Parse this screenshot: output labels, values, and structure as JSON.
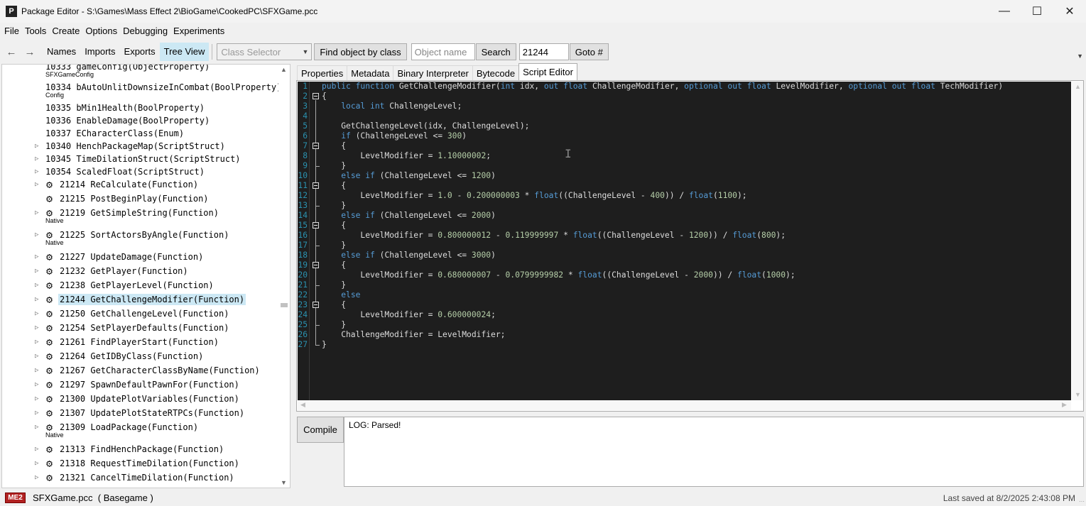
{
  "window": {
    "title": "Package Editor - S:\\Games\\Mass Effect 2\\BioGame\\CookedPC\\SFXGame.pcc",
    "icon_letter": "P",
    "minimize": "—",
    "maximize": "☐",
    "close": "✕"
  },
  "menu": [
    "File",
    "Tools",
    "Create",
    "Options",
    "Debugging",
    "Experiments"
  ],
  "toolbar": {
    "back": "←",
    "forward": "→",
    "links": [
      "Names",
      "Imports",
      "Exports",
      "Tree View"
    ],
    "active_link": "Tree View",
    "class_selector": "Class Selector",
    "find_by_class": "Find object by class",
    "object_name_placeholder": "Object name",
    "search": "Search",
    "goto_value": "21244",
    "goto": "Goto #"
  },
  "tree": {
    "rows": [
      {
        "label": "10333 gameConfig(ObjectProperty)",
        "sub": "SFXGameConfig",
        "expander": false,
        "gear": false
      },
      {
        "label": "10334 bAutoUnlitDownsizeInCombat(BoolProperty)",
        "sub": "Config",
        "expander": false,
        "gear": false
      },
      {
        "label": "10335 bMin1Health(BoolProperty)",
        "sub": "",
        "expander": false,
        "gear": false
      },
      {
        "label": "10336 EnableDamage(BoolProperty)",
        "sub": "",
        "expander": false,
        "gear": false
      },
      {
        "label": "10337 ECharacterClass(Enum)",
        "sub": "",
        "expander": false,
        "gear": false
      },
      {
        "label": "10340 HenchPackageMap(ScriptStruct)",
        "sub": "",
        "expander": true,
        "gear": false
      },
      {
        "label": "10345 TimeDilationStruct(ScriptStruct)",
        "sub": "",
        "expander": true,
        "gear": false
      },
      {
        "label": "10354 ScaledFloat(ScriptStruct)",
        "sub": "",
        "expander": true,
        "gear": false
      },
      {
        "label": "21214 ReCalculate(Function)",
        "sub": "",
        "expander": true,
        "gear": true
      },
      {
        "label": "21215 PostBeginPlay(Function)",
        "sub": "",
        "expander": false,
        "gear": true
      },
      {
        "label": "21219 GetSimpleString(Function)",
        "sub": "Native",
        "expander": true,
        "gear": true
      },
      {
        "label": "21225 SortActorsByAngle(Function)",
        "sub": "Native",
        "expander": true,
        "gear": true
      },
      {
        "label": "21227 UpdateDamage(Function)",
        "sub": "",
        "expander": true,
        "gear": true
      },
      {
        "label": "21232 GetPlayer(Function)",
        "sub": "",
        "expander": true,
        "gear": true
      },
      {
        "label": "21238 GetPlayerLevel(Function)",
        "sub": "",
        "expander": true,
        "gear": true
      },
      {
        "label": "21244 GetChallengeModifier(Function)",
        "sub": "",
        "expander": true,
        "gear": true,
        "selected": true
      },
      {
        "label": "21250 GetChallengeLevel(Function)",
        "sub": "",
        "expander": true,
        "gear": true
      },
      {
        "label": "21254 SetPlayerDefaults(Function)",
        "sub": "",
        "expander": true,
        "gear": true
      },
      {
        "label": "21261 FindPlayerStart(Function)",
        "sub": "",
        "expander": true,
        "gear": true
      },
      {
        "label": "21264 GetIDByClass(Function)",
        "sub": "",
        "expander": true,
        "gear": true
      },
      {
        "label": "21267 GetCharacterClassByName(Function)",
        "sub": "",
        "expander": true,
        "gear": true
      },
      {
        "label": "21297 SpawnDefaultPawnFor(Function)",
        "sub": "",
        "expander": true,
        "gear": true
      },
      {
        "label": "21300 UpdatePlotVariables(Function)",
        "sub": "",
        "expander": true,
        "gear": true
      },
      {
        "label": "21307 UpdatePlotStateRTPCs(Function)",
        "sub": "",
        "expander": true,
        "gear": true
      },
      {
        "label": "21309 LoadPackage(Function)",
        "sub": "Native",
        "expander": true,
        "gear": true
      },
      {
        "label": "21313 FindHenchPackage(Function)",
        "sub": "",
        "expander": true,
        "gear": true
      },
      {
        "label": "21318 RequestTimeDilation(Function)",
        "sub": "",
        "expander": true,
        "gear": true
      },
      {
        "label": "21321 CancelTimeDilation(Function)",
        "sub": "",
        "expander": true,
        "gear": true
      }
    ]
  },
  "tabs": [
    "Properties",
    "Metadata",
    "Binary Interpreter",
    "Bytecode",
    "Script Editor"
  ],
  "active_tab": "Script Editor",
  "code": {
    "line_numbers": [
      "1",
      "2",
      "3",
      "4",
      "5",
      "6",
      "7",
      "8",
      "9",
      "10",
      "11",
      "12",
      "13",
      "14",
      "15",
      "16",
      "17",
      "18",
      "19",
      "20",
      "21",
      "22",
      "23",
      "24",
      "25",
      "26",
      "27"
    ],
    "lines": [
      [
        [
          "k",
          "public"
        ],
        [
          "t",
          " "
        ],
        [
          "k",
          "function"
        ],
        [
          "t",
          " GetChallengeModifier("
        ],
        [
          "k",
          "int"
        ],
        [
          "t",
          " idx, "
        ],
        [
          "k",
          "out"
        ],
        [
          "t",
          " "
        ],
        [
          "k",
          "float"
        ],
        [
          "t",
          " ChallengeModifier, "
        ],
        [
          "k",
          "optional"
        ],
        [
          "t",
          " "
        ],
        [
          "k",
          "out"
        ],
        [
          "t",
          " "
        ],
        [
          "k",
          "float"
        ],
        [
          "t",
          " LevelModifier, "
        ],
        [
          "k",
          "optional"
        ],
        [
          "t",
          " "
        ],
        [
          "k",
          "out"
        ],
        [
          "t",
          " "
        ],
        [
          "k",
          "float"
        ],
        [
          "t",
          " TechModifier)"
        ]
      ],
      [
        [
          "t",
          "{"
        ]
      ],
      [
        [
          "t",
          "    "
        ],
        [
          "k",
          "local"
        ],
        [
          "t",
          " "
        ],
        [
          "k",
          "int"
        ],
        [
          "t",
          " ChallengeLevel;"
        ]
      ],
      [
        [
          "t",
          ""
        ]
      ],
      [
        [
          "t",
          "    GetChallengeLevel(idx, ChallengeLevel);"
        ]
      ],
      [
        [
          "t",
          "    "
        ],
        [
          "k",
          "if"
        ],
        [
          "t",
          " (ChallengeLevel <= "
        ],
        [
          "n",
          "300"
        ],
        [
          "t",
          ")"
        ]
      ],
      [
        [
          "t",
          "    {"
        ]
      ],
      [
        [
          "t",
          "        LevelModifier = "
        ],
        [
          "n",
          "1.10000002"
        ],
        [
          "t",
          ";"
        ]
      ],
      [
        [
          "t",
          "    }"
        ]
      ],
      [
        [
          "t",
          "    "
        ],
        [
          "k",
          "else"
        ],
        [
          "t",
          " "
        ],
        [
          "k",
          "if"
        ],
        [
          "t",
          " (ChallengeLevel <= "
        ],
        [
          "n",
          "1200"
        ],
        [
          "t",
          ")"
        ]
      ],
      [
        [
          "t",
          "    {"
        ]
      ],
      [
        [
          "t",
          "        LevelModifier = "
        ],
        [
          "n",
          "1.0"
        ],
        [
          "t",
          " - "
        ],
        [
          "n",
          "0.200000003"
        ],
        [
          "t",
          " * "
        ],
        [
          "k",
          "float"
        ],
        [
          "t",
          "((ChallengeLevel - "
        ],
        [
          "n",
          "400"
        ],
        [
          "t",
          ")) / "
        ],
        [
          "k",
          "float"
        ],
        [
          "t",
          "("
        ],
        [
          "n",
          "1100"
        ],
        [
          "t",
          ");"
        ]
      ],
      [
        [
          "t",
          "    }"
        ]
      ],
      [
        [
          "t",
          "    "
        ],
        [
          "k",
          "else"
        ],
        [
          "t",
          " "
        ],
        [
          "k",
          "if"
        ],
        [
          "t",
          " (ChallengeLevel <= "
        ],
        [
          "n",
          "2000"
        ],
        [
          "t",
          ")"
        ]
      ],
      [
        [
          "t",
          "    {"
        ]
      ],
      [
        [
          "t",
          "        LevelModifier = "
        ],
        [
          "n",
          "0.800000012"
        ],
        [
          "t",
          " - "
        ],
        [
          "n",
          "0.119999997"
        ],
        [
          "t",
          " * "
        ],
        [
          "k",
          "float"
        ],
        [
          "t",
          "((ChallengeLevel - "
        ],
        [
          "n",
          "1200"
        ],
        [
          "t",
          ")) / "
        ],
        [
          "k",
          "float"
        ],
        [
          "t",
          "("
        ],
        [
          "n",
          "800"
        ],
        [
          "t",
          ");"
        ]
      ],
      [
        [
          "t",
          "    }"
        ]
      ],
      [
        [
          "t",
          "    "
        ],
        [
          "k",
          "else"
        ],
        [
          "t",
          " "
        ],
        [
          "k",
          "if"
        ],
        [
          "t",
          " (ChallengeLevel <= "
        ],
        [
          "n",
          "3000"
        ],
        [
          "t",
          ")"
        ]
      ],
      [
        [
          "t",
          "    {"
        ]
      ],
      [
        [
          "t",
          "        LevelModifier = "
        ],
        [
          "n",
          "0.680000007"
        ],
        [
          "t",
          " - "
        ],
        [
          "n",
          "0.0799999982"
        ],
        [
          "t",
          " * "
        ],
        [
          "k",
          "float"
        ],
        [
          "t",
          "((ChallengeLevel - "
        ],
        [
          "n",
          "2000"
        ],
        [
          "t",
          ")) / "
        ],
        [
          "k",
          "float"
        ],
        [
          "t",
          "("
        ],
        [
          "n",
          "1000"
        ],
        [
          "t",
          ");"
        ]
      ],
      [
        [
          "t",
          "    }"
        ]
      ],
      [
        [
          "t",
          "    "
        ],
        [
          "k",
          "else"
        ]
      ],
      [
        [
          "t",
          "    {"
        ]
      ],
      [
        [
          "t",
          "        LevelModifier = "
        ],
        [
          "n",
          "0.600000024"
        ],
        [
          "t",
          ";"
        ]
      ],
      [
        [
          "t",
          "    }"
        ]
      ],
      [
        [
          "t",
          "    ChallengeModifier = LevelModifier;"
        ]
      ],
      [
        [
          "t",
          "}"
        ]
      ]
    ],
    "colors": {
      "keyword": "#569cd6",
      "number": "#b5cea8",
      "text": "#dcdcdc",
      "line_number": "#2b91af",
      "background": "#1e1e1e"
    }
  },
  "compile": {
    "button": "Compile",
    "log": "LOG: Parsed!"
  },
  "status": {
    "game_badge": "ME2",
    "file": "SFXGame.pcc  ( Basegame )",
    "saved": "Last saved at 8/2/2025 2:43:08 PM"
  }
}
